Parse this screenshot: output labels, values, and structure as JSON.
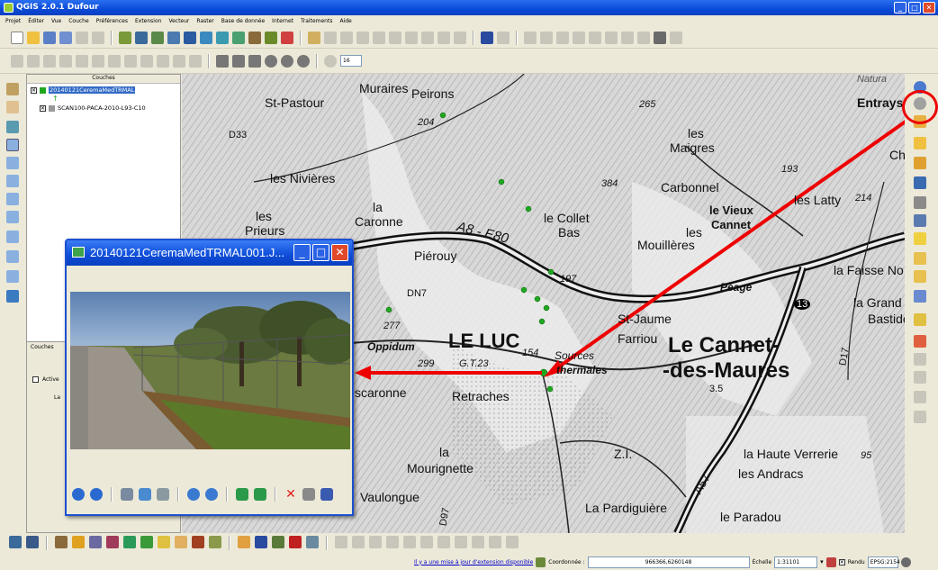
{
  "window": {
    "title": "QGIS 2.0.1 Dufour",
    "min": "_",
    "max": "□",
    "close": "✕"
  },
  "menu": [
    "Projet",
    "Éditer",
    "Vue",
    "Couche",
    "Préférences",
    "Extension",
    "Vecteur",
    "Raster",
    "Base de donnée",
    "Internet",
    "Traitements",
    "Aide"
  ],
  "toolbar": {
    "scale_input": "16"
  },
  "layers_panel": {
    "title": "Couches",
    "layers": [
      {
        "name": "20140121CeremaMedTRMAL",
        "checked": true,
        "selected": true
      },
      {
        "name": "SCAN100-PACA-2010-L93-C10",
        "checked": true,
        "selected": false
      }
    ],
    "lower_tab": "Couches",
    "active_label": "Active",
    "lower_header": "La"
  },
  "map": {
    "labels": [
      "Muraires",
      "Peirons",
      "St-Pastour",
      "204",
      "D33",
      "les Nivières",
      "la",
      "Caronne",
      "les",
      "Prieurs",
      "A8 - E80",
      "le Collet",
      "Bas",
      "384",
      "Carbonnel",
      "le Vieux",
      "Cannet",
      "les",
      "Mouillères",
      "les Latty",
      "214",
      "193",
      "les",
      "Maigres",
      "265",
      "Entrays",
      "Ch",
      "Natura",
      "Piérouy",
      "197",
      "DN7",
      "Péage",
      "13",
      "la Faisse No",
      "la Grand",
      "Bastide",
      "277",
      "Oppidum",
      "LE LUC",
      "299",
      "G.T.23",
      "154",
      "Sources",
      "thermales",
      "St-Jaume",
      "Farriou",
      "Le Cannet-",
      "-des-Maures",
      "3.5",
      "Retraches",
      "scaronne",
      "la",
      "Mourignette",
      "Vaulongue",
      "La Pardiguière",
      "A57",
      "Z.I.",
      "la Haute Verrerie",
      "les Andracs",
      "95",
      "le Paradou",
      "D97",
      "D17"
    ]
  },
  "popup": {
    "title": "20140121CeremaMedTRMAL001.J..."
  },
  "statusbar": {
    "update_link": "Il y a une mise à jour d'extension disponible",
    "coord_label": "Coordonnée :",
    "coord_value": "966366,6260148",
    "scale_label": "Échelle",
    "scale_value": "1:31101",
    "render_label": "Rendu",
    "crs": "EPSG:2154"
  },
  "colors": {
    "xp_blue": "#0a4ad8",
    "highlight_red": "#e00000",
    "feature_green": "#1fa81f"
  }
}
